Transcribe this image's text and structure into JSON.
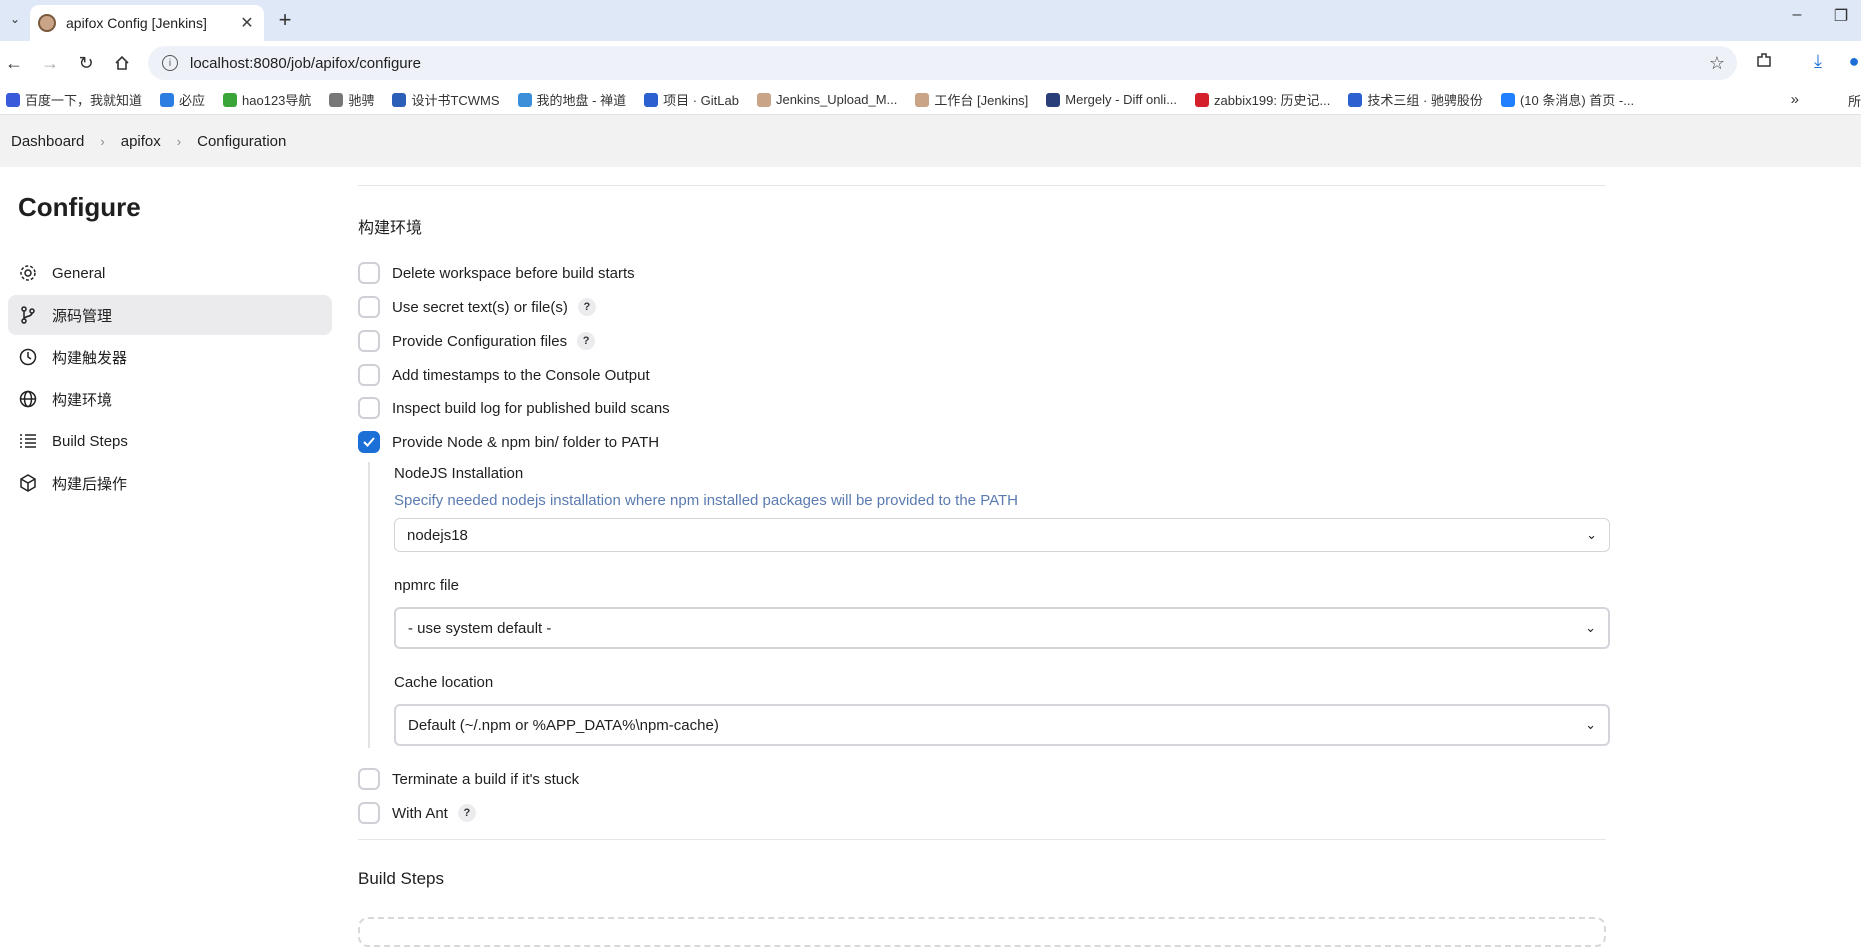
{
  "browser": {
    "tab_title": "apifox Config [Jenkins]",
    "url": "localhost:8080/job/apifox/configure",
    "bookmarks": [
      {
        "label": "百度一下，我就知道",
        "color": "#3a5bd9"
      },
      {
        "label": "必应",
        "color": "#2a7de1"
      },
      {
        "label": "hao123导航",
        "color": "#3aa63a"
      },
      {
        "label": "驰骋",
        "color": "#777777"
      },
      {
        "label": "设计书TCWMS",
        "color": "#2b5fb8"
      },
      {
        "label": "我的地盘 - 禅道",
        "color": "#3b8fd8"
      },
      {
        "label": "项目 · GitLab",
        "color": "#2c60d0"
      },
      {
        "label": "Jenkins_Upload_M...",
        "color": "#c9a486"
      },
      {
        "label": "工作台 [Jenkins]",
        "color": "#c9a486"
      },
      {
        "label": "Mergely - Diff onli...",
        "color": "#2a3f7a"
      },
      {
        "label": "zabbix199: 历史记...",
        "color": "#d4202a"
      },
      {
        "label": "技术三组 · 驰骋股份",
        "color": "#2c60d0"
      },
      {
        "label": "(10 条消息) 首页 -...",
        "color": "#1e80ff"
      }
    ],
    "bookmarks_more": "»",
    "bookmarks_right": "所"
  },
  "breadcrumb": {
    "items": [
      "Dashboard",
      "apifox",
      "Configuration"
    ]
  },
  "page_title": "Configure",
  "sidebar": {
    "items": [
      {
        "label": "General",
        "icon": "gear-icon"
      },
      {
        "label": "源码管理",
        "icon": "branch-icon",
        "active": true
      },
      {
        "label": "构建触发器",
        "icon": "clock-icon"
      },
      {
        "label": "构建环境",
        "icon": "globe-icon"
      },
      {
        "label": "Build Steps",
        "icon": "list-icon"
      },
      {
        "label": "构建后操作",
        "icon": "cube-icon"
      }
    ]
  },
  "build_env": {
    "title": "构建环境",
    "options": [
      {
        "label": "Delete workspace before build starts",
        "checked": false,
        "help": false
      },
      {
        "label": "Use secret text(s) or file(s)",
        "checked": false,
        "help": true
      },
      {
        "label": "Provide Configuration files",
        "checked": false,
        "help": true
      },
      {
        "label": "Add timestamps to the Console Output",
        "checked": false,
        "help": false
      },
      {
        "label": "Inspect build log for published build scans",
        "checked": false,
        "help": false
      },
      {
        "label": "Provide Node & npm bin/ folder to PATH",
        "checked": true,
        "help": false
      },
      {
        "label": "Terminate a build if it's stuck",
        "checked": false,
        "help": false
      },
      {
        "label": "With Ant",
        "checked": false,
        "help": true
      }
    ],
    "nodejs": {
      "installation_label": "NodeJS Installation",
      "installation_desc": "Specify needed nodejs installation where npm installed packages will be provided to the PATH",
      "installation_value": "nodejs18",
      "npmrc_label": "npmrc file",
      "npmrc_value": "- use system default -",
      "cache_label": "Cache location",
      "cache_value": "Default (~/.npm or %APP_DATA%\\npm-cache)"
    },
    "help_glyph": "?"
  },
  "build_steps": {
    "title": "Build Steps"
  },
  "colors": {
    "accent": "#1b6fd6",
    "description": "#5b7bb0",
    "breadcrumb_bg": "#f2f2f3"
  }
}
